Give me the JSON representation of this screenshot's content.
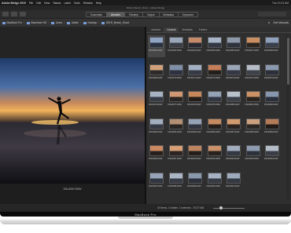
{
  "menubar": {
    "app_name": "Adobe Bridge 2019",
    "items": [
      "File",
      "Edit",
      "View",
      "Stacks",
      "Label",
      "Tools",
      "Window",
      "Help"
    ],
    "clock": "Tue 10:24 AM"
  },
  "window": {
    "title": "DSLR_Beach_Shoot - Adobe Bridge"
  },
  "toolbar": {
    "workspaces": [
      "Essentials",
      "Libraries",
      "Filmstrip",
      "Output",
      "Metadata",
      "Keywords"
    ],
    "active_workspace": "Libraries"
  },
  "path": {
    "crumbs": [
      "MacBook Pro",
      "Macintosh HD",
      "Users",
      "Adobe",
      "Desktop",
      "DSLR_Beach_Shoot"
    ],
    "sort_label": "Sort Manually"
  },
  "tabs": [
    "Libraries",
    "Content",
    "Metadata",
    "Folders"
  ],
  "active_tab": "Content",
  "preview": {
    "caption": "DSL8262.RAW"
  },
  "thumbnails": [
    {
      "label": "DSL8262.RAW",
      "sky": "#8fa3c2",
      "ground": "#2b3242"
    },
    {
      "label": "DSL8263.RAW",
      "sky": "#9aa7bb",
      "ground": "#3a3d46"
    },
    {
      "label": "DSL8264.RAW",
      "sky": "#c48a6a",
      "ground": "#2a2a33"
    },
    {
      "label": "DSL8265.RAW",
      "sky": "#a8b4c8",
      "ground": "#333844"
    },
    {
      "label": "DSL8266.RAW",
      "sky": "#8d98a9",
      "ground": "#2f333d"
    },
    {
      "label": "DSL8267.RAW",
      "sky": "#c98f62",
      "ground": "#2d2620"
    },
    {
      "label": "DSL8268.RAW",
      "sky": "#8fa0bc",
      "ground": "#3a3f4c"
    },
    {
      "label": "DSL8269.RAW",
      "sky": "#d0a17a",
      "ground": "#2e2a2a"
    },
    {
      "label": "DSL8270.RAW",
      "sky": "#7f8fa6",
      "ground": "#2c3240"
    },
    {
      "label": "DSL8271.RAW",
      "sky": "#a3b0c4",
      "ground": "#353a46"
    },
    {
      "label": "DSL8272.RAW",
      "sky": "#c47e5a",
      "ground": "#251f1c"
    },
    {
      "label": "DSL8273.RAW",
      "sky": "#9ba6b8",
      "ground": "#343844"
    },
    {
      "label": "DSL8274.RAW",
      "sky": "#b6bcc6",
      "ground": "#3e424a"
    },
    {
      "label": "DSL8275.RAW",
      "sky": "#8b99ae",
      "ground": "#2a2f3a"
    },
    {
      "label": "DSL8276.RAW",
      "sky": "#a7b3c3",
      "ground": "#363b46"
    },
    {
      "label": "DSL8277.RAW",
      "sky": "#cf9873",
      "ground": "#2a2422"
    },
    {
      "label": "DSL8278.RAW",
      "sky": "#c8875b",
      "ground": "#241d19"
    },
    {
      "label": "DSL8279.RAW",
      "sky": "#94a2b6",
      "ground": "#323744"
    },
    {
      "label": "DSL8280.RAW",
      "sky": "#b8c1cc",
      "ground": "#3b3f48"
    },
    {
      "label": "DSL8281.RAW",
      "sky": "#cc9266",
      "ground": "#2a231e"
    },
    {
      "label": "DSL8282.RAW",
      "sky": "#8797ae",
      "ground": "#2b303c"
    },
    {
      "label": "DSL8283.RAW",
      "sky": "#a2adbe",
      "ground": "#363a45"
    },
    {
      "label": "DSL8284.RAW",
      "sky": "#b39074",
      "ground": "#2b2624"
    },
    {
      "label": "DSL8285.RAW",
      "sky": "#96a3b6",
      "ground": "#313641"
    },
    {
      "label": "DSL8286.RAW",
      "sky": "#c58a60",
      "ground": "#261f1b"
    },
    {
      "label": "DSL8287.RAW",
      "sky": "#d29b6e",
      "ground": "#2c2420"
    },
    {
      "label": "DSL8288.RAW",
      "sky": "#caa07e",
      "ground": "#2e2825"
    },
    {
      "label": "DSL8289.RAW",
      "sky": "#b47b58",
      "ground": "#231c19"
    },
    {
      "label": "DSL8290.RAW",
      "sky": "#c98961",
      "ground": "#27201c"
    },
    {
      "label": "DSL8291.RAW",
      "sky": "#d59e74",
      "ground": "#2d2521"
    },
    {
      "label": "DSL8292.RAW",
      "sky": "#bd8460",
      "ground": "#251e1a"
    },
    {
      "label": "DSL8293.RAW",
      "sky": "#c9906a",
      "ground": "#29221e"
    },
    {
      "label": "DSL8294.RAW",
      "sky": "#a1acbd",
      "ground": "#333843"
    },
    {
      "label": "DSL8295.RAW",
      "sky": "#8c9bb0",
      "ground": "#2c313c"
    },
    {
      "label": "DSL8296.RAW",
      "sky": "#b4bcc8",
      "ground": "#3a3e47"
    },
    {
      "label": "DSL8297.RAW",
      "sky": "#97a4b7",
      "ground": "#313642"
    },
    {
      "label": "DSL8298.RAW",
      "sky": "#aab5c5",
      "ground": "#363b46"
    },
    {
      "label": "DSL8299.RAW",
      "sky": "#8a98ac",
      "ground": "#2b303b"
    },
    {
      "label": "DSL8300.RAW",
      "sky": "#a6b1c1",
      "ground": "#353a45"
    },
    {
      "label": "DSL8301.RAW",
      "sky": "#9daabc",
      "ground": "#333843"
    }
  ],
  "status": {
    "text": "40 items, 1 hidden, 1 selected - 75.07 MB"
  },
  "laptop": {
    "brand": "MacBook Pro"
  }
}
